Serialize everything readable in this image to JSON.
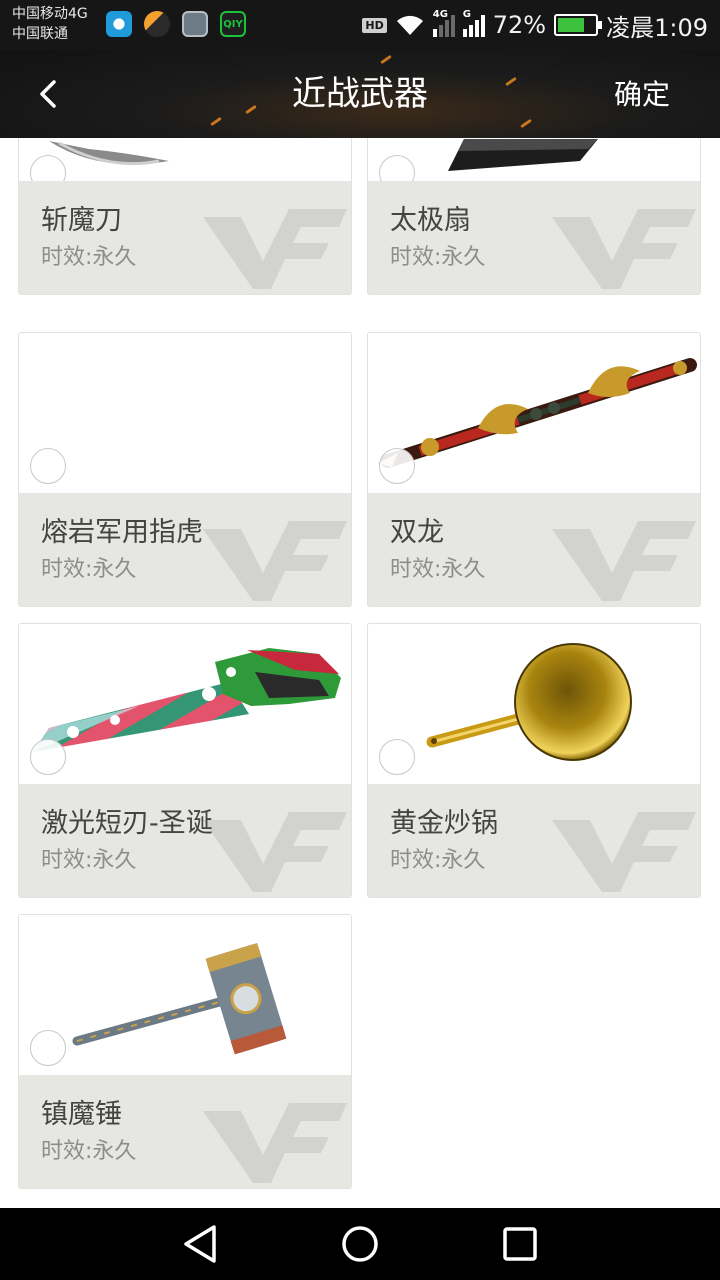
{
  "status_bar": {
    "carrier_1": "中国移动4G",
    "carrier_2": "中国联通",
    "notification_icons": [
      "browser-icon",
      "game-icon",
      "gallery-icon",
      "iqiyi-icon"
    ],
    "iqiyi_label": "QIY",
    "hd_label": "HD",
    "sim1_tag": "4G",
    "sim2_tag": "G",
    "battery_percent": "72%",
    "battery_level": 0.72,
    "time": "凌晨1:09"
  },
  "toolbar": {
    "back_icon": "chevron-left-icon",
    "title": "近战武器",
    "confirm_label": "确定"
  },
  "weapons": [
    {
      "name": "斩魔刀",
      "duration": "时效:永久",
      "icon": "blade-icon"
    },
    {
      "name": "太极扇",
      "duration": "时效:永久",
      "icon": "fan-icon"
    },
    {
      "name": "熔岩军用指虎",
      "duration": "时效:永久",
      "icon": "knuckle-icon"
    },
    {
      "name": "双龙",
      "duration": "时效:永久",
      "icon": "dragon-staff-icon"
    },
    {
      "name": "激光短刃-圣诞",
      "duration": "时效:永久",
      "icon": "laser-blade-icon"
    },
    {
      "name": "黄金炒锅",
      "duration": "时效:永久",
      "icon": "golden-pan-icon"
    },
    {
      "name": "镇魔锤",
      "duration": "时效:永久",
      "icon": "hammer-icon"
    }
  ],
  "nav_bar": {
    "back_icon": "triangle-back-icon",
    "home_icon": "circle-home-icon",
    "recent_icon": "square-recent-icon"
  },
  "colors": {
    "toolbar_bg": "#161616",
    "card_info_bg": "#e6e6e3",
    "name_text": "#444444",
    "duration_text": "#8d8d8d",
    "battery_green": "#3cc23c",
    "accent_spark": "#e8871e"
  }
}
